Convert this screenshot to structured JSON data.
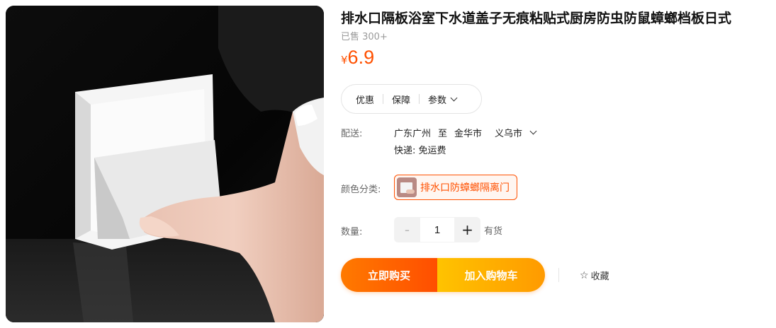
{
  "product": {
    "title": "排水口隔板浴室下水道盖子无痕粘贴式厨房防虫防鼠蟑螂档板日式",
    "sold": "已售 300+",
    "currency": "¥",
    "price": "6.9"
  },
  "tabs": [
    {
      "label": "优惠"
    },
    {
      "label": "保障"
    },
    {
      "label": "参数"
    }
  ],
  "shipping": {
    "label": "配送:",
    "from": "广东广州",
    "to_word": "至",
    "destination": "金华市",
    "district": "义乌市",
    "express": "快递: 免运费"
  },
  "sku": {
    "label": "颜色分类:",
    "option": "排水口防蟑螂隔离门"
  },
  "quantity": {
    "label": "数量:",
    "minus": "-",
    "value": "1",
    "plus": "+",
    "stock": "有货"
  },
  "actions": {
    "buy_now": "立即购买",
    "add_cart": "加入购物车",
    "favorite_icon": "star-outline-icon",
    "favorite": "收藏"
  },
  "colors": {
    "accent": "#ff5000",
    "buy_gradient": [
      "#ff7a00",
      "#ff4e00"
    ],
    "cart_gradient": [
      "#ffc300",
      "#ff9a00"
    ]
  }
}
